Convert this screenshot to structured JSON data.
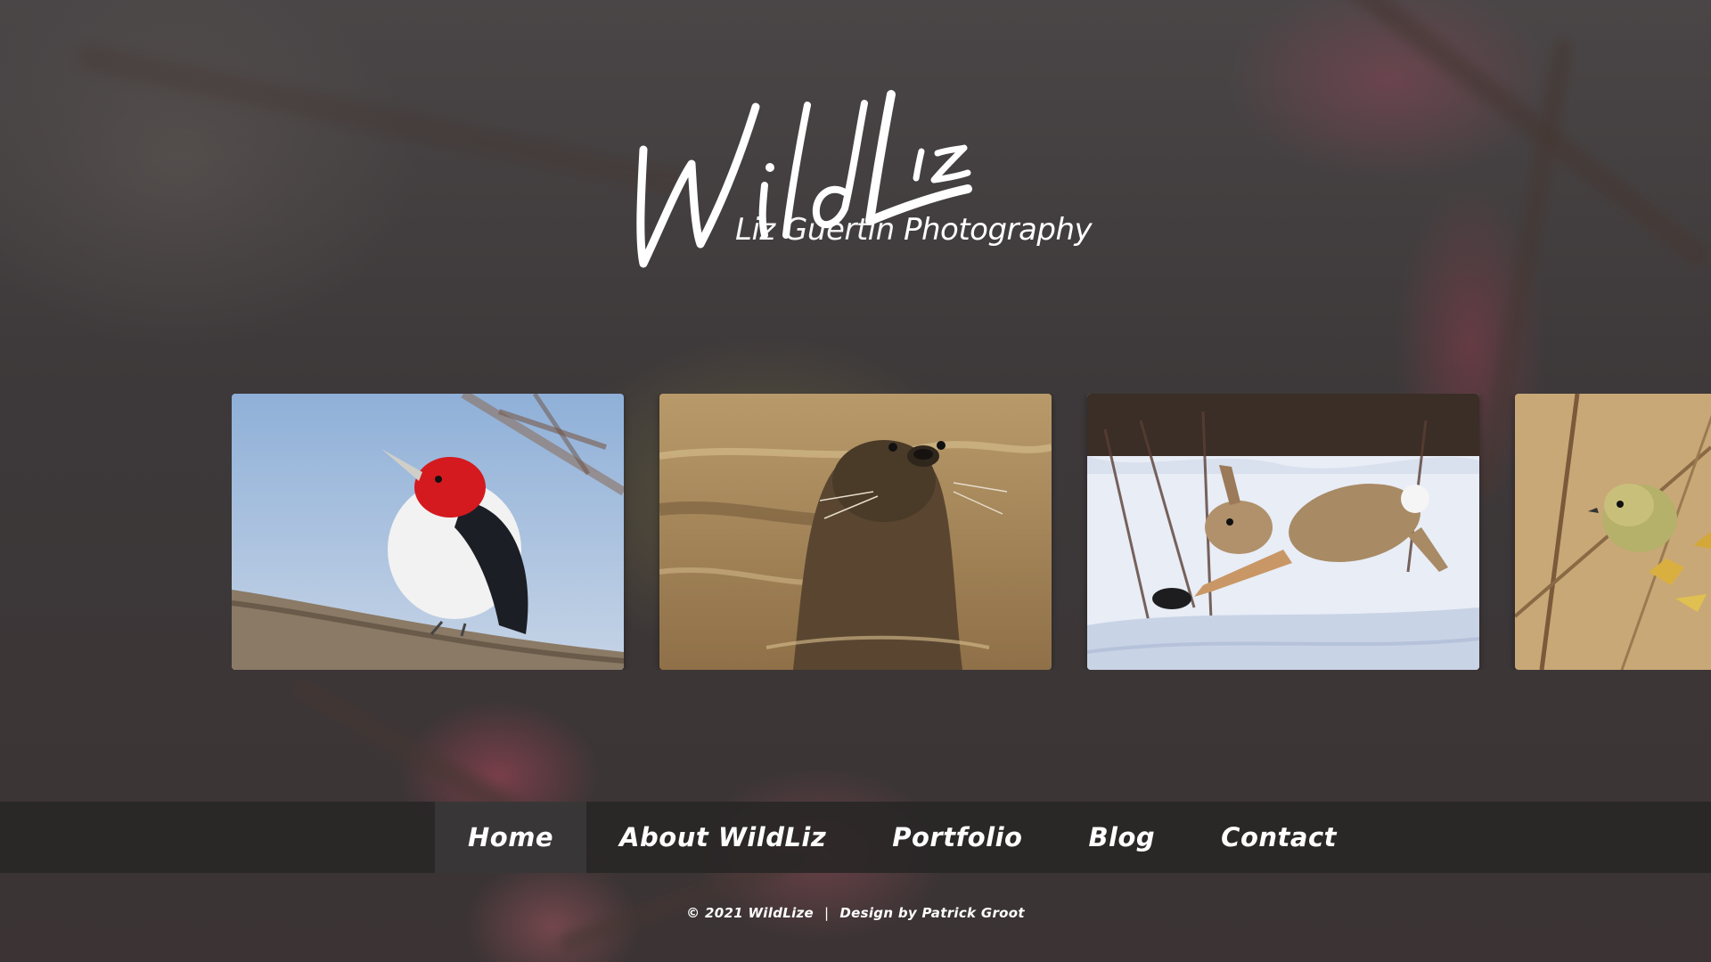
{
  "brand": {
    "logo_script": "WildLiz",
    "subtitle_light": "Liz Guertin",
    "subtitle_bold": "Photography"
  },
  "gallery": {
    "photos": [
      {
        "subject": "red-headed woodpecker"
      },
      {
        "subject": "river otter"
      },
      {
        "subject": "cottontail rabbit leaping in snow"
      },
      {
        "subject": "ruby-crowned kinglet"
      }
    ]
  },
  "nav": {
    "items": [
      {
        "label": "Home",
        "active": true
      },
      {
        "label": "About WildLiz",
        "active": false
      },
      {
        "label": "Portfolio",
        "active": false
      },
      {
        "label": "Blog",
        "active": false
      },
      {
        "label": "Contact",
        "active": false
      }
    ]
  },
  "footer": {
    "copyright": "© 2021 WildLize",
    "separator": "|",
    "credit": "Design by Patrick Groot"
  },
  "colors": {
    "background": "#3d393a",
    "nav_bar": "#2a2627",
    "nav_active": "#3a3738",
    "text": "#ffffff"
  }
}
